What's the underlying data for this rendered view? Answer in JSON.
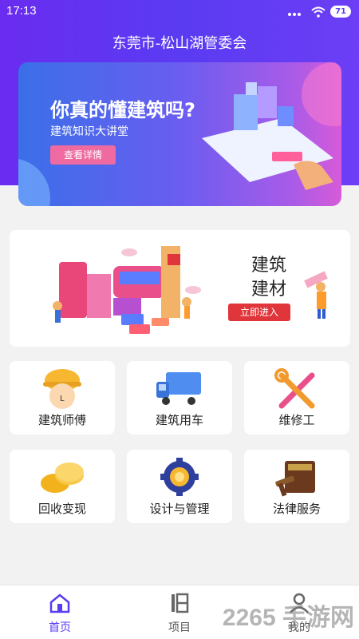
{
  "status": {
    "time": "17:13",
    "battery": "71"
  },
  "header": {
    "title": "东莞市-松山湖管委会"
  },
  "banner": {
    "headline": "你真的懂建筑吗?",
    "subtitle": "建筑知识大讲堂",
    "button": "查看详情"
  },
  "featured": {
    "title_line1": "建筑",
    "title_line2": "建材",
    "button": "立即进入"
  },
  "tiles": [
    {
      "label": "建筑师傅",
      "icon": "hard-hat-worker-icon"
    },
    {
      "label": "建筑用车",
      "icon": "truck-icon"
    },
    {
      "label": "维修工",
      "icon": "tools-icon"
    },
    {
      "label": "回收变现",
      "icon": "coins-icon"
    },
    {
      "label": "设计与管理",
      "icon": "gear-icon"
    },
    {
      "label": "法律服务",
      "icon": "law-book-icon"
    }
  ],
  "tabs": [
    {
      "label": "首页",
      "icon": "home-icon",
      "active": true
    },
    {
      "label": "项目",
      "icon": "project-icon",
      "active": false
    },
    {
      "label": "我的",
      "icon": "user-icon",
      "active": false
    }
  ],
  "watermark": "2265 手游网",
  "colors": {
    "brand": "#5a3bf2",
    "accent": "#e0363b",
    "banner_btn": "#ef6aa0"
  }
}
